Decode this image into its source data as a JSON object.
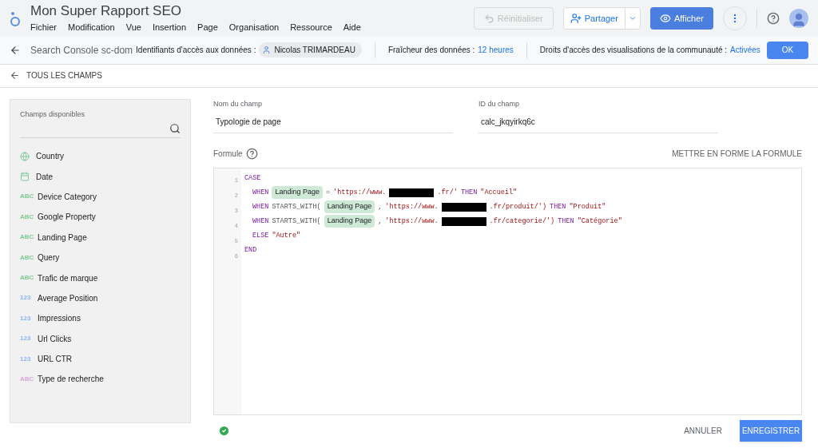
{
  "header": {
    "title": "Mon Super Rapport SEO",
    "menu": [
      "Fichier",
      "Modification",
      "Vue",
      "Insertion",
      "Page",
      "Organisation",
      "Ressource",
      "Aide"
    ],
    "reset_button": {
      "label": "Réinitialiser",
      "disabled": true
    },
    "share_button": "Partager",
    "view_button": "Afficher"
  },
  "source_bar": {
    "source": "Search Console sc-dom",
    "credentials_label": "Identifiants d'accès aux données :",
    "credentials_user": "Nicolas TRIMARDEAU",
    "freshness_label": "Fraîcheur des données :",
    "freshness_value": "12 heures",
    "rights_label": "Droits d'accès des visualisations de la communauté :",
    "rights_value": "Activées",
    "ok_button": "OK"
  },
  "breadcrumb": "TOUS LES CHAMPS",
  "fields_panel": {
    "title": "Champs disponibles",
    "items": [
      {
        "kind": "geo",
        "label": "Country"
      },
      {
        "kind": "date",
        "label": "Date"
      },
      {
        "kind": "text",
        "badge": "ABC",
        "label": "Device Category",
        "color": "#81c995"
      },
      {
        "kind": "text",
        "badge": "ABC",
        "label": "Google Property",
        "color": "#81c995"
      },
      {
        "kind": "text",
        "badge": "ABC",
        "label": "Landing Page",
        "color": "#81c995"
      },
      {
        "kind": "text",
        "badge": "ABC",
        "label": "Query",
        "color": "#81c995"
      },
      {
        "kind": "text",
        "badge": "ABC",
        "label": "Trafic de marque",
        "color": "#81c995"
      },
      {
        "kind": "number",
        "badge": "123",
        "label": "Average Position",
        "color": "#8ab4f8"
      },
      {
        "kind": "number",
        "badge": "123",
        "label": "Impressions",
        "color": "#8ab4f8"
      },
      {
        "kind": "number",
        "badge": "123",
        "label": "Url Clicks",
        "color": "#8ab4f8"
      },
      {
        "kind": "number",
        "badge": "123",
        "label": "URL CTR",
        "color": "#8ab4f8"
      },
      {
        "kind": "text",
        "badge": "ABC",
        "label": "Type de recherche",
        "color": "#d7a6d9"
      }
    ]
  },
  "editor": {
    "name_label": "Nom du champ",
    "name_value": "Typologie de page",
    "id_label": "ID du champ",
    "id_value": "calc_jkqyirkq6c",
    "formula_label": "Formule",
    "format_button": "METTRE EN FORME LA FORMULE",
    "lines": [
      {
        "number": "1",
        "tokens": [
          {
            "kind": "keyword",
            "text": "CASE"
          }
        ]
      },
      {
        "number": "2",
        "tokens": [
          {
            "kind": "keyword",
            "text": "WHEN"
          },
          {
            "kind": "chip",
            "text": "Landing Page"
          },
          {
            "kind": "plain",
            "text": "="
          },
          {
            "kind": "string",
            "text": "'https://www."
          },
          {
            "kind": "redacted"
          },
          {
            "kind": "string",
            "text": ".fr/'"
          },
          {
            "kind": "keyword",
            "text": "THEN"
          },
          {
            "kind": "string",
            "text": "\"Accueil\""
          }
        ]
      },
      {
        "number": "3",
        "tokens": [
          {
            "kind": "keyword",
            "text": "WHEN"
          },
          {
            "kind": "plain",
            "text": "STARTS_WITH("
          },
          {
            "kind": "chip",
            "text": "Landing Page"
          },
          {
            "kind": "plain",
            "text": ","
          },
          {
            "kind": "string",
            "text": "'https://www."
          },
          {
            "kind": "redacted"
          },
          {
            "kind": "string",
            "text": ".fr/produit/')"
          },
          {
            "kind": "keyword",
            "text": "THEN"
          },
          {
            "kind": "string",
            "text": "\"Produit\""
          }
        ]
      },
      {
        "number": "4",
        "tokens": [
          {
            "kind": "keyword",
            "text": "WHEN"
          },
          {
            "kind": "plain",
            "text": "STARTS_WITH("
          },
          {
            "kind": "chip",
            "text": "Landing Page"
          },
          {
            "kind": "plain",
            "text": ","
          },
          {
            "kind": "string",
            "text": "'https://www."
          },
          {
            "kind": "redacted"
          },
          {
            "kind": "string",
            "text": ".fr/categorie/')"
          },
          {
            "kind": "keyword",
            "text": "THEN"
          },
          {
            "kind": "string",
            "text": "\"Catégorie\""
          }
        ]
      },
      {
        "number": "5",
        "tokens": [
          {
            "kind": "keyword",
            "text": "ELSE"
          },
          {
            "kind": "string",
            "text": "\"Autre\""
          }
        ]
      },
      {
        "number": "6",
        "tokens": [
          {
            "kind": "keyword",
            "text": "END"
          }
        ]
      }
    ],
    "valid": true,
    "cancel_button": "ANNULER",
    "save_button": "ENREGISTRER"
  }
}
